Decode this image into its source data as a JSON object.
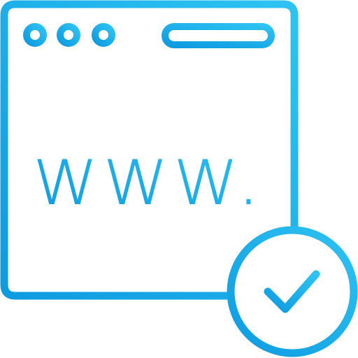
{
  "icon": {
    "name": "website-verified-icon",
    "text": "www.",
    "gradient_start": "#0E9BE0",
    "gradient_end": "#2EC3F2",
    "background": "#ffffff"
  }
}
